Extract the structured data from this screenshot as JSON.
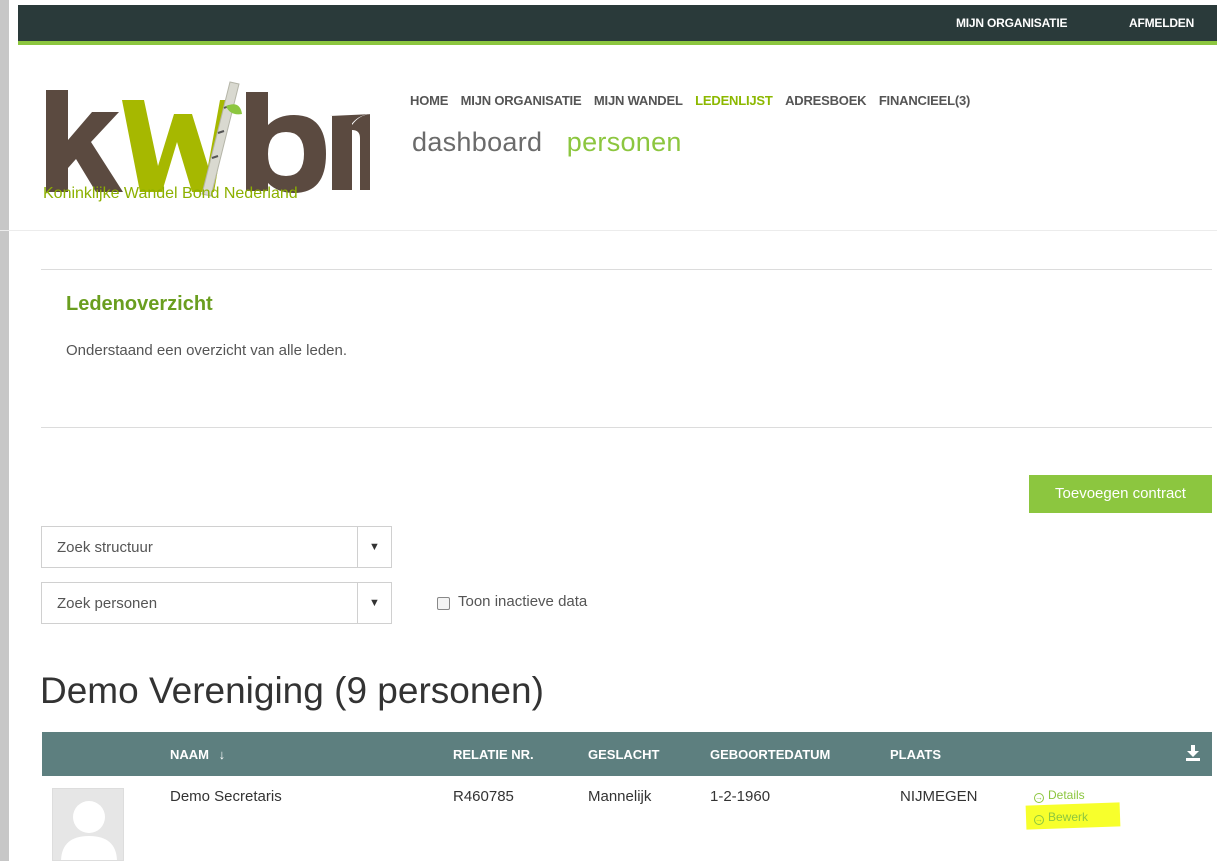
{
  "topbar": {
    "mijn_organisatie": "MIJN ORGANISATIE",
    "afmelden": "AFMELDEN"
  },
  "logo": {
    "letters": "kWbn",
    "tagline": "Koninklijke Wandel Bond Nederland"
  },
  "mainnav": [
    {
      "label": "HOME",
      "active": false
    },
    {
      "label": "MIJN ORGANISATIE",
      "active": false
    },
    {
      "label": "MIJN WANDEL",
      "active": false
    },
    {
      "label": "LEDENLIJST",
      "active": true
    },
    {
      "label": "ADRESBOEK",
      "active": false
    },
    {
      "label": "FINANCIEEL(3)",
      "active": false
    }
  ],
  "subnav": [
    {
      "label": "dashboard",
      "active": false
    },
    {
      "label": "personen",
      "active": true
    }
  ],
  "page": {
    "title": "Ledenoverzicht",
    "description": "Onderstaand een overzicht van alle leden."
  },
  "actions": {
    "add_contract": "Toevoegen contract"
  },
  "filters": {
    "structure_placeholder": "Zoek structuur",
    "persons_placeholder": "Zoek personen",
    "inactive_label": "Toon inactieve data",
    "inactive_checked": false
  },
  "group": {
    "title": "Demo Vereniging (9 personen)"
  },
  "table": {
    "columns": [
      "NAAM",
      "RELATIE NR.",
      "GESLACHT",
      "GEBOORTEDATUM",
      "PLAATS"
    ],
    "sort_indicator": "↓",
    "rows": [
      {
        "naam": "Demo Secretaris",
        "relatie_nr": "R460785",
        "geslacht": "Mannelijk",
        "geboortedatum": "1-2-1960",
        "plaats": "NIJMEGEN",
        "details_label": "Details",
        "bewerk_label": "Bewerk"
      }
    ]
  },
  "colors": {
    "brand_green": "#8cc63f",
    "topbar": "#2a3a3a",
    "table_header": "#5d7f7f",
    "highlight": "#f7ff2c"
  }
}
